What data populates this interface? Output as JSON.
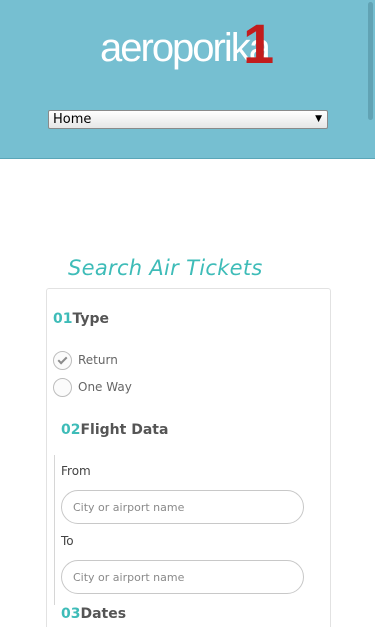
{
  "header": {
    "logo_text": "aeroporika",
    "logo_number": "1",
    "nav_select": {
      "selected": "Home",
      "arrow_icon": "triangle-down-icon"
    }
  },
  "colors": {
    "header_bg": "#76bfd1",
    "accent": "#3ebcb8",
    "logo_number": "#c21d1d"
  },
  "search": {
    "title": "Search Air Tickets",
    "step1": {
      "num": "01",
      "label": "Type"
    },
    "trip_types": [
      {
        "label": "Return",
        "checked": true
      },
      {
        "label": "One Way",
        "checked": false
      }
    ],
    "step2": {
      "num": "02",
      "label": "Flight Data"
    },
    "from": {
      "label": "From",
      "placeholder": "City or airport name",
      "value": ""
    },
    "to": {
      "label": "To",
      "placeholder": "City or airport name",
      "value": ""
    },
    "step3": {
      "num": "03",
      "label": "Dates"
    }
  }
}
